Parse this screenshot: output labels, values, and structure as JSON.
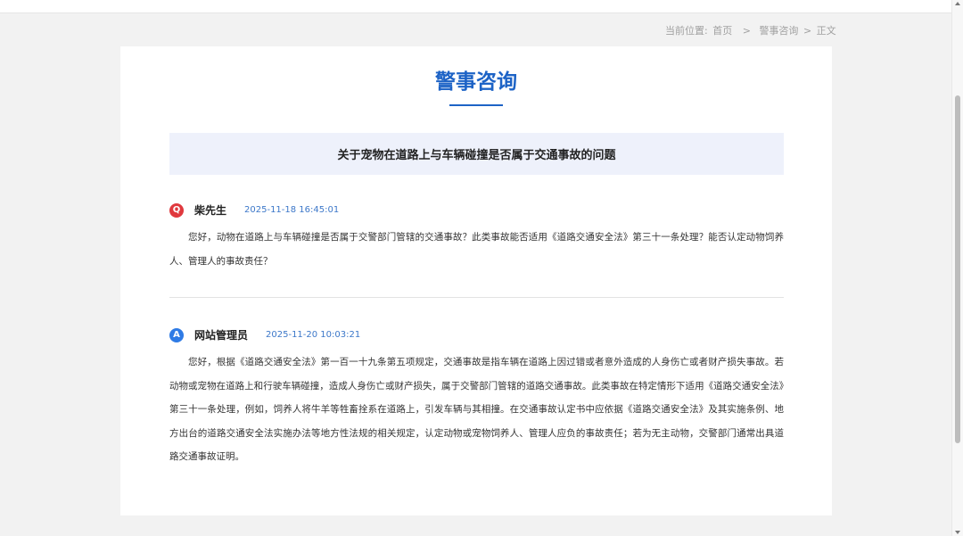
{
  "breadcrumb": {
    "label": "当前位置:",
    "items": [
      "首页",
      "警事咨询",
      "正文"
    ],
    "separators": [
      ">",
      ">"
    ]
  },
  "page_title": "警事咨询",
  "subject": "关于宠物在道路上与车辆碰撞是否属于交通事故的问题",
  "question": {
    "badge": "Q",
    "author": "柴先生",
    "time": "2025-11-18 16:45:01",
    "body": "您好，动物在道路上与车辆碰撞是否属于交警部门管辖的交通事故？此类事故能否适用《道路交通安全法》第三十一条处理？能否认定动物饲养人、管理人的事故责任？"
  },
  "answer": {
    "badge": "A",
    "author": "网站管理员",
    "time": "2025-11-20 10:03:21",
    "body": "您好，根据《道路交通安全法》第一百一十九条第五项规定，交通事故是指车辆在道路上因过错或者意外造成的人身伤亡或者财产损失事故。若动物或宠物在道路上和行驶车辆碰撞，造成人身伤亡或财产损失，属于交警部门管辖的道路交通事故。此类事故在特定情形下适用《道路交通安全法》第三十一条处理，例如，饲养人将牛羊等牲畜拴系在道路上，引发车辆与其相撞。在交通事故认定书中应依据《道路交通安全法》及其实施条例、地方出台的道路交通安全法实施办法等地方性法规的相关规定，认定动物或宠物饲养人、管理人应负的事故责任；若为无主动物，交警部门通常出具道路交通事故证明。"
  },
  "colors": {
    "accent": "#1d63c6",
    "question_badge": "#e0393e",
    "answer_badge": "#2f7be5",
    "subject_bg": "#eef1fb"
  }
}
